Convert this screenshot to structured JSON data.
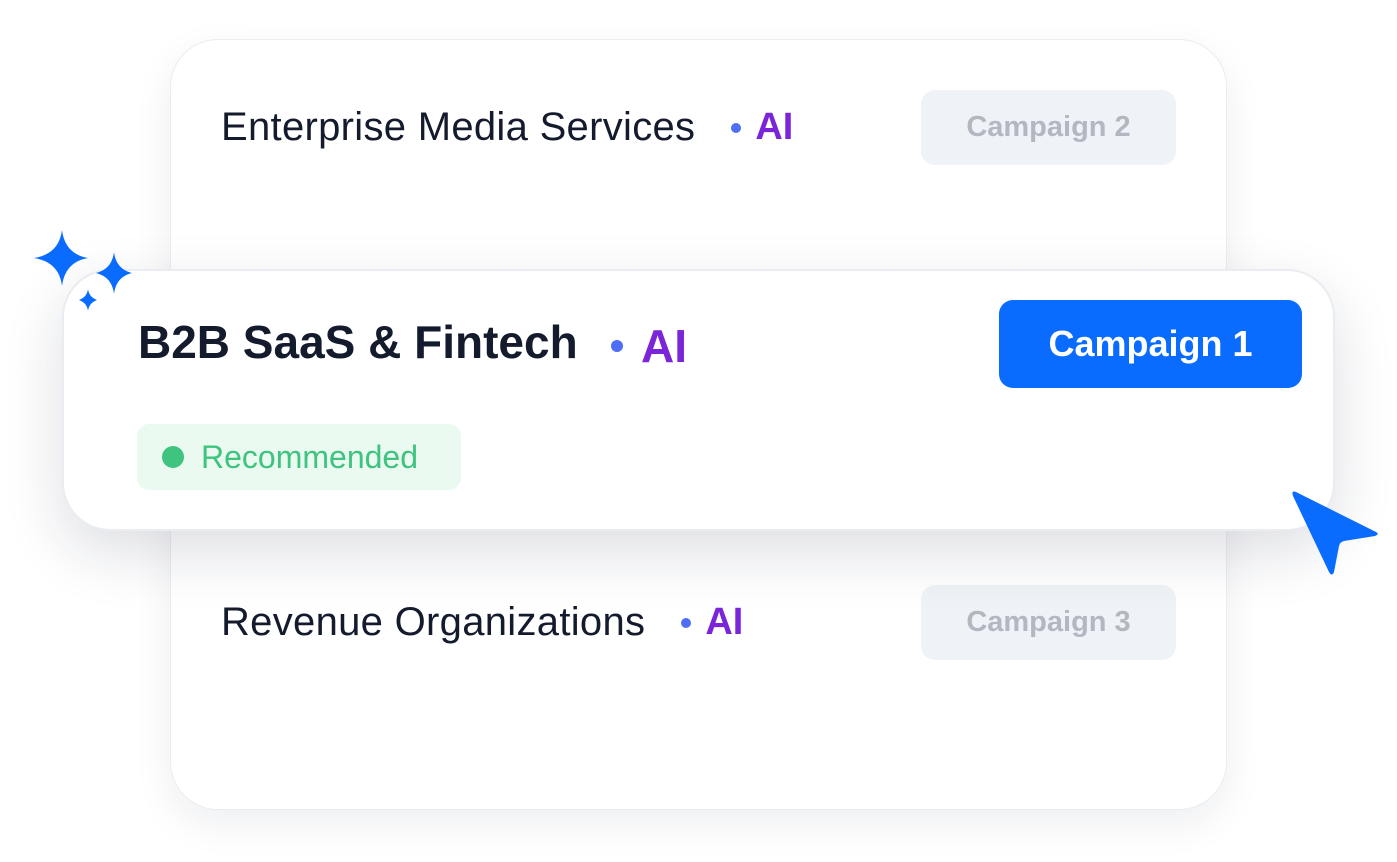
{
  "segments": [
    {
      "title": "Enterprise Media Services",
      "ai_label": "AI",
      "button_label": "Campaign 2"
    },
    {
      "title": "B2B SaaS & Fintech",
      "ai_label": "AI",
      "button_label": "Campaign 1",
      "badge": "Recommended"
    },
    {
      "title": "Revenue Organizations",
      "ai_label": "AI",
      "button_label": "Campaign 3"
    }
  ],
  "icons": {
    "decoration": "sparkles-icon",
    "pointer": "cursor-pointer-icon"
  },
  "colors": {
    "primary": "#0a6cff",
    "ai": "#7b25d8",
    "ai_dot": "#4f6ef7",
    "recommended": "#3ec47f",
    "recommended_bg": "#eafaf1",
    "muted_button_bg": "#eff2f6",
    "muted_button_text": "#b2b7c1"
  }
}
